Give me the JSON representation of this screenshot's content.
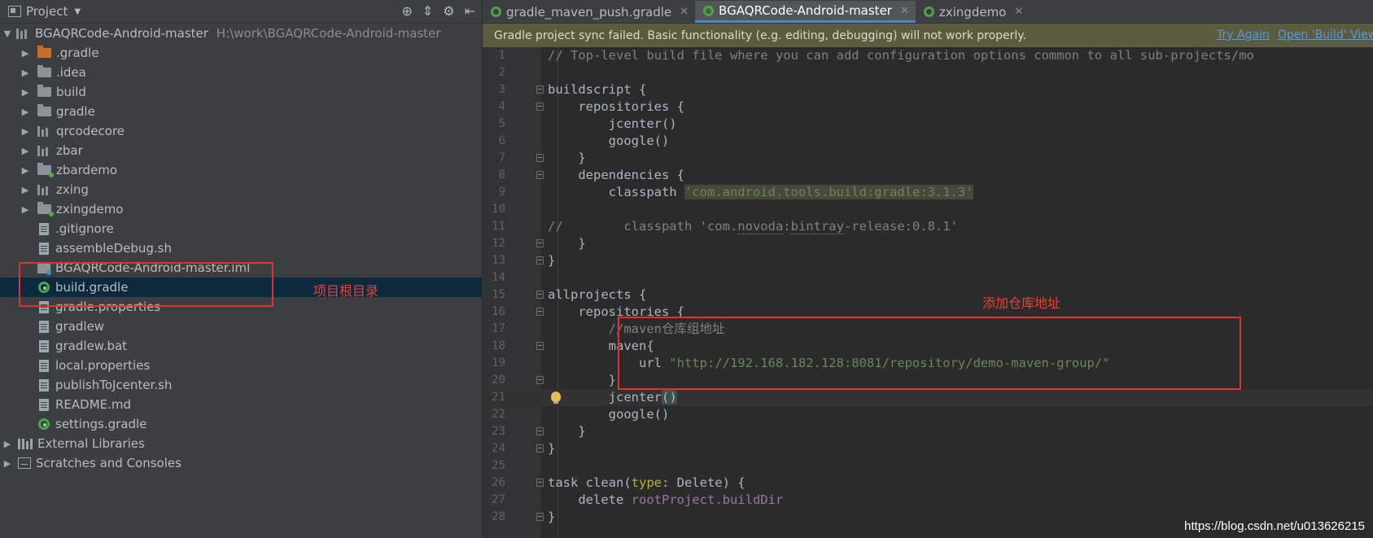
{
  "project_panel": {
    "title": "Project",
    "root": {
      "name": "BGAQRCode-Android-master",
      "path": "H:\\work\\BGAQRCode-Android-master"
    },
    "items": [
      {
        "label": ".gradle",
        "icon": "folder-orange-icon",
        "arrow": true
      },
      {
        "label": ".idea",
        "icon": "folder-icon",
        "arrow": true
      },
      {
        "label": "build",
        "icon": "folder-icon",
        "arrow": true
      },
      {
        "label": "gradle",
        "icon": "folder-icon",
        "arrow": true
      },
      {
        "label": "qrcodecore",
        "icon": "module-icon",
        "arrow": true
      },
      {
        "label": "zbar",
        "icon": "module-icon",
        "arrow": true
      },
      {
        "label": "zbardemo",
        "icon": "module-app-icon",
        "arrow": true
      },
      {
        "label": "zxing",
        "icon": "module-icon",
        "arrow": true
      },
      {
        "label": "zxingdemo",
        "icon": "module-app-icon",
        "arrow": true
      },
      {
        "label": ".gitignore",
        "icon": "file-icon"
      },
      {
        "label": "assembleDebug.sh",
        "icon": "file-icon"
      },
      {
        "label": "BGAQRCode-Android-master.iml",
        "icon": "iml-icon"
      },
      {
        "label": "build.gradle",
        "icon": "gradle-icon",
        "selected": true
      },
      {
        "label": "gradle.properties",
        "icon": "file-icon"
      },
      {
        "label": "gradlew",
        "icon": "file-icon"
      },
      {
        "label": "gradlew.bat",
        "icon": "file-icon"
      },
      {
        "label": "local.properties",
        "icon": "file-icon"
      },
      {
        "label": "publishToJcenter.sh",
        "icon": "file-icon"
      },
      {
        "label": "README.md",
        "icon": "file-icon"
      },
      {
        "label": "settings.gradle",
        "icon": "gradle-icon"
      }
    ],
    "external_libraries": "External Libraries",
    "scratches": "Scratches and Consoles"
  },
  "annotations": {
    "root_dir_label": "项目根目录",
    "repo_label": "添加仓库地址"
  },
  "tabs": [
    {
      "label": "gradle_maven_push.gradle",
      "active": false
    },
    {
      "label": "BGAQRCode-Android-master",
      "active": true
    },
    {
      "label": "zxingdemo",
      "active": false
    }
  ],
  "notification": {
    "message": "Gradle project sync failed. Basic functionality (e.g. editing, debugging) will not work properly.",
    "try_again": "Try Again",
    "open_build_view": "Open 'Build' View"
  },
  "code_lines": [
    "1",
    "2",
    "3",
    "4",
    "5",
    "6",
    "7",
    "8",
    "9",
    "10",
    "11",
    "12",
    "13",
    "14",
    "15",
    "16",
    "17",
    "18",
    "19",
    "20",
    "21",
    "22",
    "23",
    "24",
    "25",
    "26",
    "27",
    "28"
  ],
  "code": {
    "l1": "// Top-level build file where you can add configuration options common to all sub-projects/mo",
    "l3": "buildscript {",
    "l4": "    repositories {",
    "l5": "        jcenter()",
    "l6": "        google()",
    "l7": "    }",
    "l8": "    dependencies {",
    "l9a": "        classpath ",
    "l9b": "'com.android.tools.build:gradle:3.1.3'",
    "l11a": "//        classpath 'com.",
    "l11b": "novoda",
    "l11c": ":",
    "l11d": "bintray",
    "l11e": "-release:0.8.1'",
    "l12": "    }",
    "l13": "}",
    "l15": "allprojects {",
    "l16": "    repositories {",
    "l17": "        //maven仓库组地址",
    "l18": "        maven{",
    "l19a": "            url ",
    "l19b": "\"http://192.168.182.128:8081/repository/demo-maven-group/\"",
    "l20": "        }",
    "l21a": "        jcenter",
    "l21b": "()",
    "l22": "        google()",
    "l23": "    }",
    "l24": "}",
    "l26a": "task clean(",
    "l26b": "type",
    "l26c": ": Delete) {",
    "l27a": "    delete ",
    "l27b": "rootProject",
    "l27c": ".buildDir",
    "l28": "}"
  },
  "watermark": "https://blog.csdn.net/u013626215"
}
